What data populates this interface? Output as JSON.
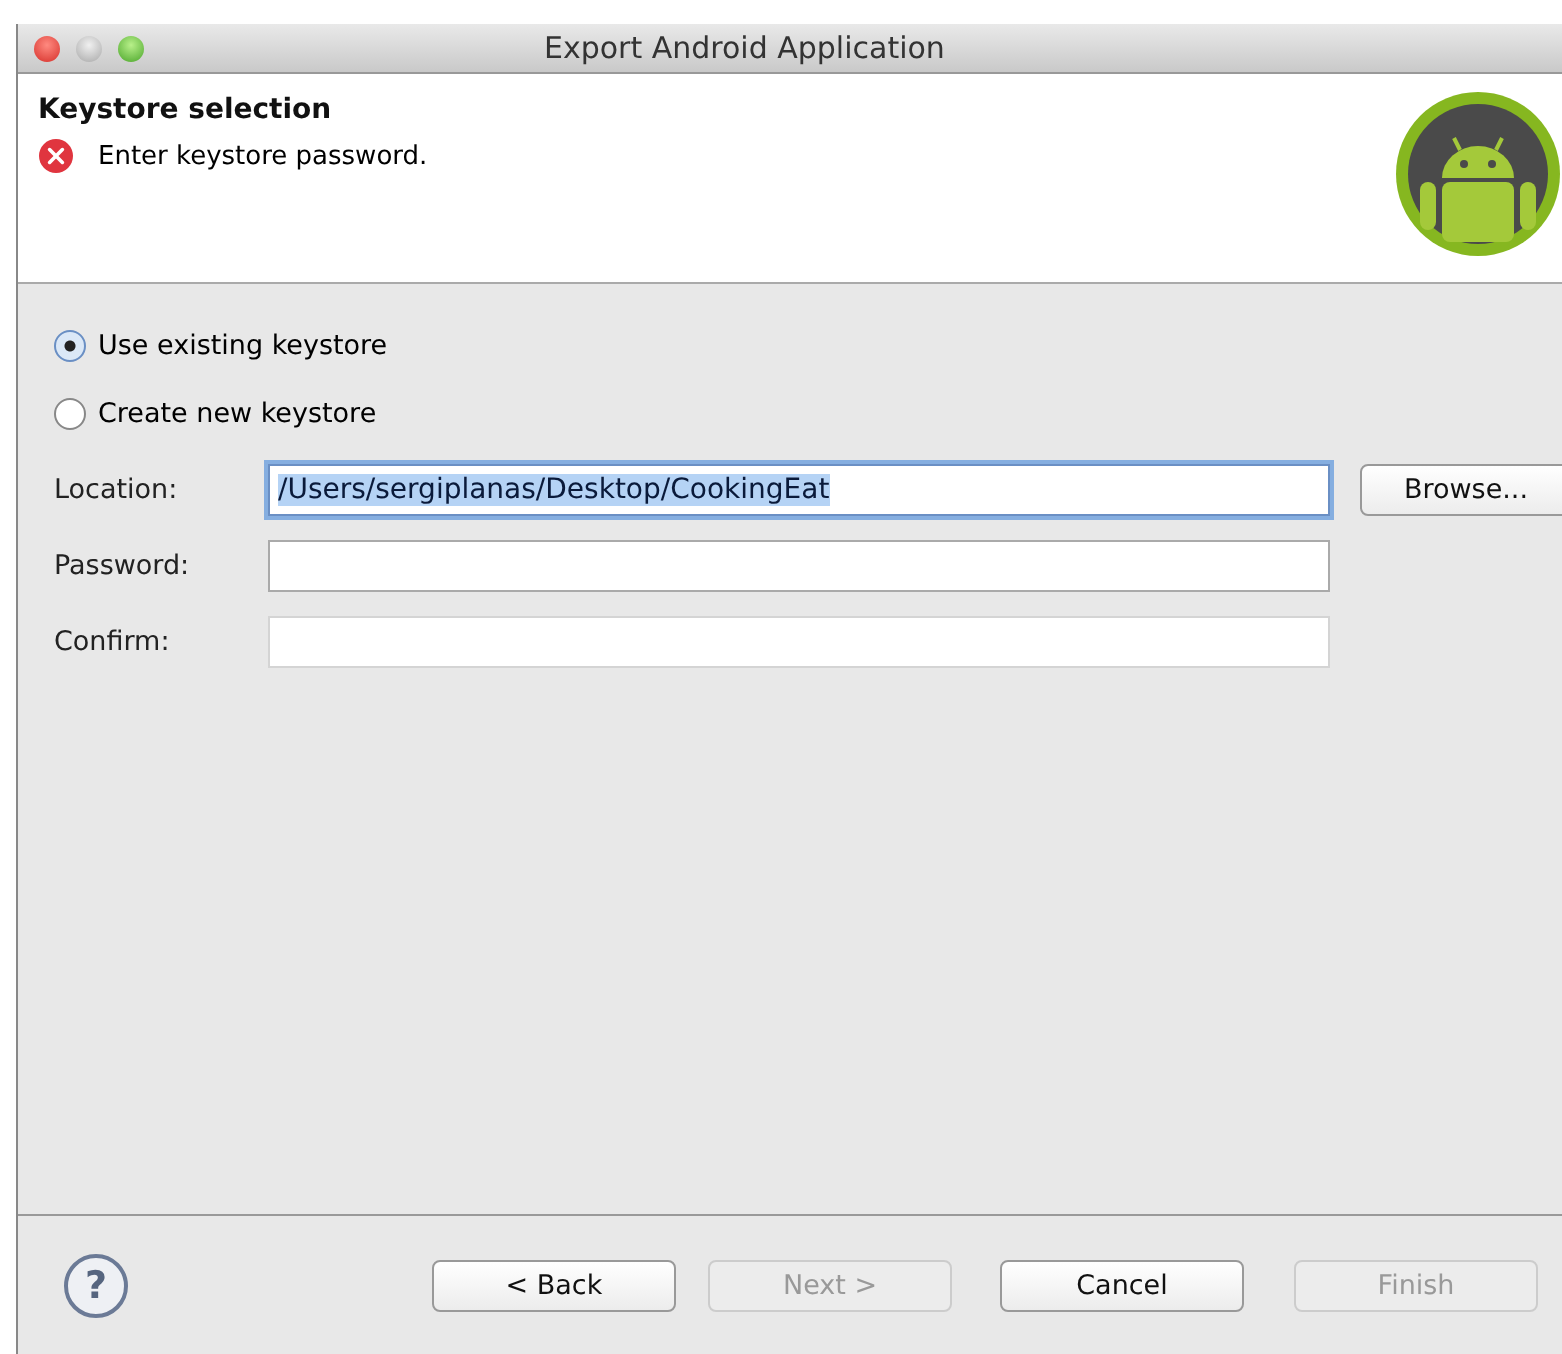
{
  "window": {
    "title": "Export Android Application"
  },
  "header": {
    "title": "Keystore selection",
    "message": "Enter keystore password."
  },
  "options": [
    {
      "label": "Use existing keystore",
      "selected": true
    },
    {
      "label": "Create new keystore",
      "selected": false
    }
  ],
  "fields": [
    {
      "label": "Location:",
      "value": "/Users/sergiplanas/Desktop/CookingEat",
      "text_selected": true,
      "focused": true,
      "disabled": false
    },
    {
      "label": "Password:",
      "focused": false,
      "disabled": false
    },
    {
      "label": "Confirm:",
      "focused": false,
      "disabled": true
    }
  ],
  "browse_button": "Browse...",
  "help": "?",
  "buttons": [
    {
      "label": "< Back",
      "disabled": false
    },
    {
      "label": "Next >",
      "disabled": true
    },
    {
      "label": "Cancel",
      "disabled": false
    },
    {
      "label": "Finish",
      "disabled": true
    }
  ]
}
